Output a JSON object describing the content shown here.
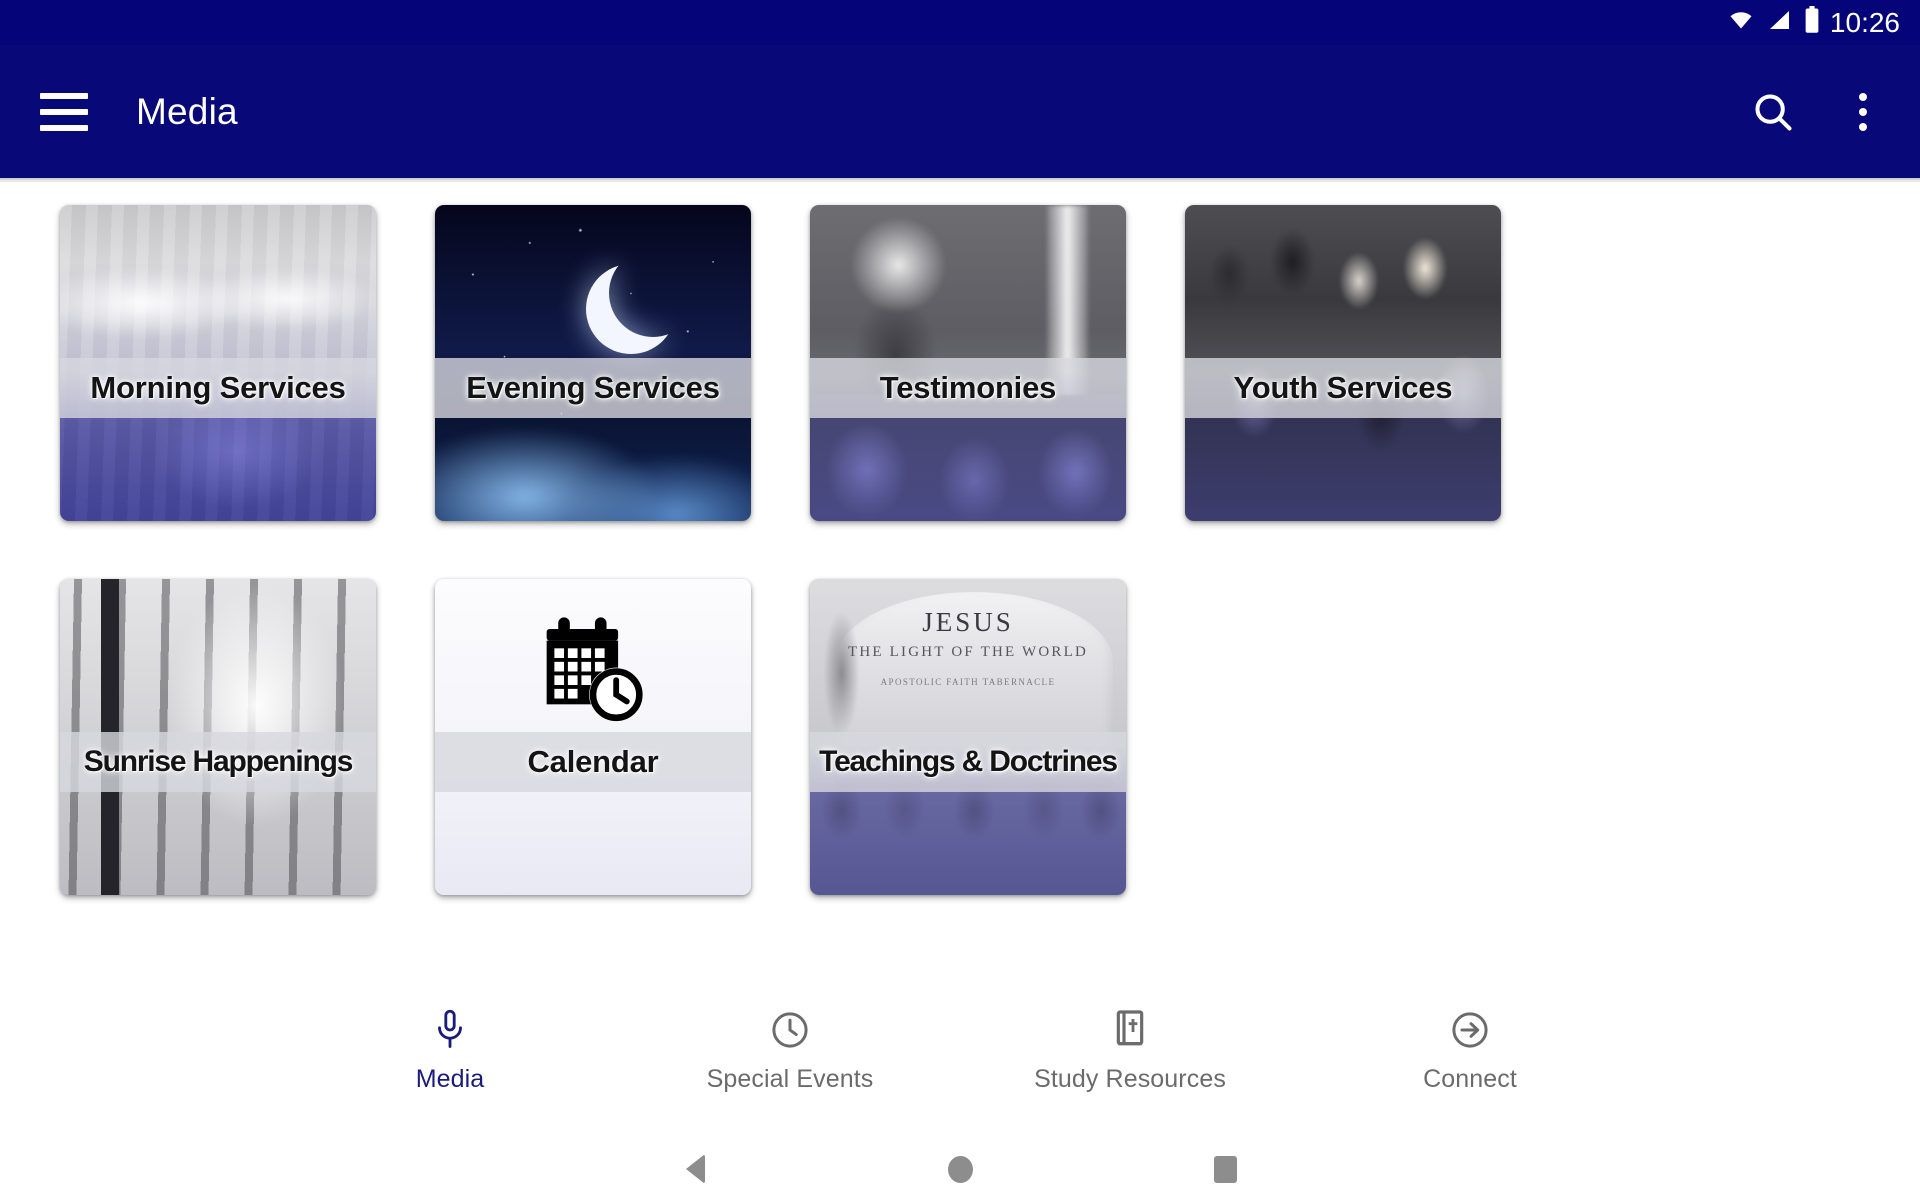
{
  "status_bar": {
    "time": "10:26",
    "icons": [
      "wifi-icon",
      "cellular-signal-icon",
      "battery-icon"
    ]
  },
  "toolbar": {
    "title": "Media",
    "menu_icon": "hamburger-menu-icon",
    "search_icon": "search-icon",
    "overflow_icon": "more-vertical-icon",
    "background_color": "#080878"
  },
  "grid": {
    "cards": [
      {
        "label": "Morning Services",
        "art": "art-morning"
      },
      {
        "label": "Evening Services",
        "art": "art-evening"
      },
      {
        "label": "Testimonies",
        "art": "art-testimonies"
      },
      {
        "label": "Youth Services",
        "art": "art-youth"
      },
      {
        "label": "Sunrise Happenings",
        "art": "art-sunrise"
      },
      {
        "label": "Calendar",
        "art": "art-calendar"
      },
      {
        "label": "Teachings & Doctrines",
        "art": "art-teach"
      }
    ]
  },
  "teachings_art_text": {
    "heading": "JESUS",
    "subtitle": "THE LIGHT OF THE WORLD",
    "small": "APOSTOLIC FAITH\nTABERNACLE"
  },
  "bottom_nav": {
    "active_color": "#1b1b7a",
    "inactive_color": "#6b6b6b",
    "items": [
      {
        "label": "Media",
        "icon": "microphone-icon",
        "active": true
      },
      {
        "label": "Special Events",
        "icon": "clock-icon",
        "active": false
      },
      {
        "label": "Study Resources",
        "icon": "bible-book-icon",
        "active": false
      },
      {
        "label": "Connect",
        "icon": "arrow-right-circle-icon",
        "active": false
      }
    ]
  },
  "system_nav": {
    "back": "back-triangle-icon",
    "home": "home-circle-icon",
    "recents": "recents-square-icon"
  }
}
